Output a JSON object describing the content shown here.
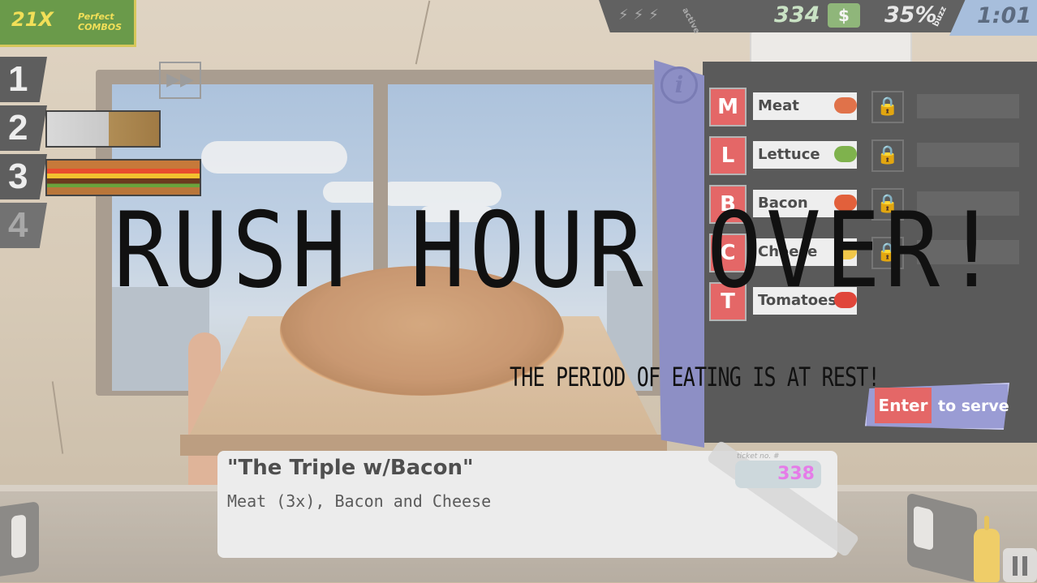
{
  "combo": {
    "count": "21X",
    "label_line1": "Perfect",
    "label_line2": "COMBOS"
  },
  "slots": [
    "1",
    "2",
    "3",
    "4"
  ],
  "hud": {
    "active_label": "active",
    "money": "334",
    "money_icon": "$",
    "buzz": "35%",
    "buzz_label": "buzz",
    "timer": "1:01"
  },
  "ingredients": [
    {
      "key": "M",
      "name": "Meat",
      "color": "#e0724a"
    },
    {
      "key": "L",
      "name": "Lettuce",
      "color": "#7fb24d"
    },
    {
      "key": "B",
      "name": "Bacon",
      "color": "#e2603b"
    },
    {
      "key": "C",
      "name": "Cheese",
      "color": "#f2c84a"
    },
    {
      "key": "T",
      "name": "Tomatoes",
      "color": "#e0463a"
    }
  ],
  "serve": {
    "key": "Enter",
    "hint": "to serve"
  },
  "order": {
    "title": "\"The Triple w/Bacon\"",
    "description": "Meat (3x), Bacon and Cheese",
    "ticket_label": "ticket no. #",
    "ticket_number": "338"
  },
  "overlay": {
    "title": "RUSH HOUR OVER!",
    "subtitle": "THE PERIOD OF EATING IS AT REST!"
  },
  "icons": {
    "active": "lightning-icon",
    "money": "cash-icon",
    "info": "info-icon",
    "lock": "lock-icon",
    "fast_forward": "fast-forward-icon",
    "pause": "pause-icon"
  }
}
